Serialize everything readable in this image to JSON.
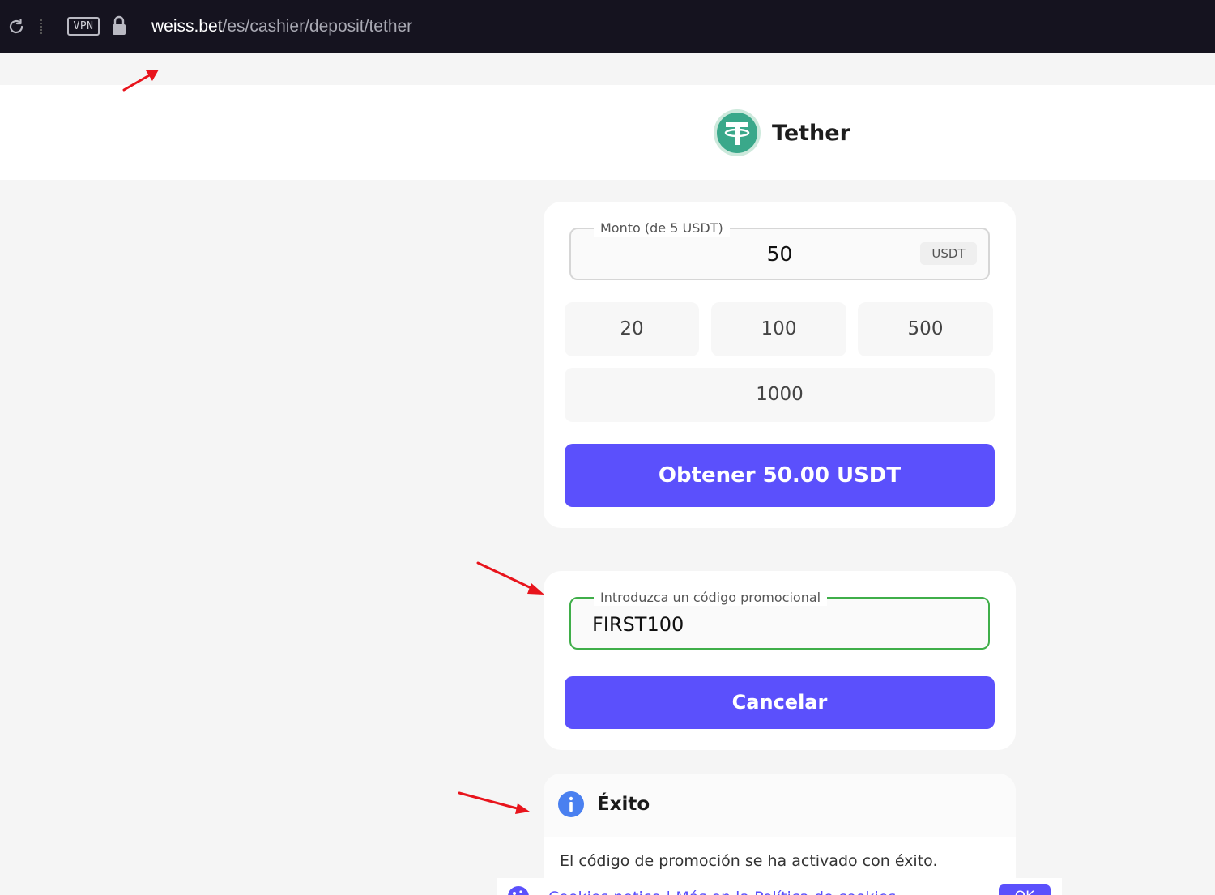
{
  "browser": {
    "vpn_label": "VPN",
    "url_host": "weiss.bet",
    "url_path": "/es/cashier/deposit/tether"
  },
  "header": {
    "title": "Tether",
    "logo_icon": "tether-logo-icon",
    "logo_color": "#3aa88a"
  },
  "amount_card": {
    "legend": "Monto (de 5 USDT)",
    "value": "50",
    "currency": "USDT",
    "presets": [
      "20",
      "100",
      "500",
      "1000"
    ],
    "submit_label": "Obtener 50.00 USDT"
  },
  "promo_card": {
    "legend": "Introduzca un código promocional",
    "value": "FIRST100",
    "cancel_label": "Cancelar",
    "border_color": "#3fae49"
  },
  "success_card": {
    "title": "Éxito",
    "message": "El código de promoción se ha activado con éxito.",
    "icon": "info-icon"
  },
  "cookie_banner": {
    "text": "Cookies notice  |  Más en la Política de cookies",
    "accept_label": "OK"
  },
  "colors": {
    "accent": "#5b50fc",
    "browser_bar": "#15131f",
    "annotation_arrow": "#e8141c"
  }
}
